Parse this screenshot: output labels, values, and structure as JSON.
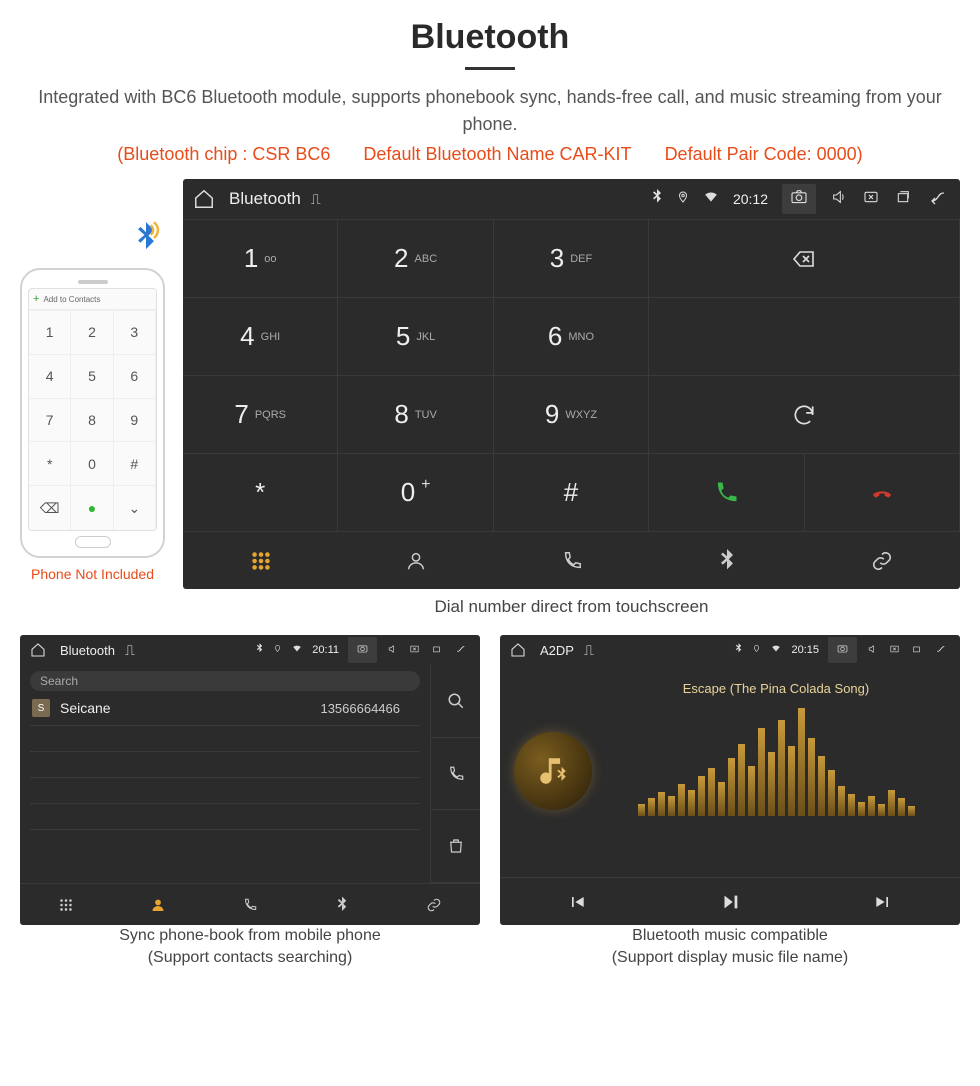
{
  "header": {
    "title": "Bluetooth",
    "desc": "Integrated with BC6 Bluetooth module, supports phonebook sync, hands-free call, and music streaming from your phone.",
    "spec_chip": "(Bluetooth chip : CSR BC6",
    "spec_name": "Default Bluetooth Name CAR-KIT",
    "spec_code": "Default Pair Code: 0000)"
  },
  "phone": {
    "add_label": "Add to Contacts",
    "note": "Phone Not Included",
    "keys": [
      "1",
      "2",
      "3",
      "4",
      "5",
      "6",
      "7",
      "8",
      "9",
      "*",
      "0",
      "#"
    ]
  },
  "dialer": {
    "statusbar": {
      "title": "Bluetooth",
      "time": "20:12"
    },
    "keys": [
      {
        "n": "1",
        "s": "ᴏᴏ"
      },
      {
        "n": "2",
        "s": "ABC"
      },
      {
        "n": "3",
        "s": "DEF"
      },
      {
        "n": "4",
        "s": "GHI"
      },
      {
        "n": "5",
        "s": "JKL"
      },
      {
        "n": "6",
        "s": "MNO"
      },
      {
        "n": "7",
        "s": "PQRS"
      },
      {
        "n": "8",
        "s": "TUV"
      },
      {
        "n": "9",
        "s": "WXYZ"
      },
      {
        "n": "*",
        "s": ""
      },
      {
        "n": "0",
        "s": "+",
        "sup": true
      },
      {
        "n": "#",
        "s": ""
      }
    ],
    "caption": "Dial number direct from touchscreen"
  },
  "phonebook": {
    "statusbar": {
      "title": "Bluetooth",
      "time": "20:11"
    },
    "search_placeholder": "Search",
    "contact": {
      "initial": "S",
      "name": "Seicane",
      "number": "13566664466"
    },
    "caption_line1": "Sync phone-book from mobile phone",
    "caption_line2": "(Support contacts searching)"
  },
  "music": {
    "statusbar": {
      "title": "A2DP",
      "time": "20:15"
    },
    "track": "Escape (The Pina Colada Song)",
    "eq_bars": [
      12,
      18,
      24,
      20,
      32,
      26,
      40,
      48,
      34,
      58,
      72,
      50,
      88,
      64,
      96,
      70,
      108,
      78,
      60,
      46,
      30,
      22,
      14,
      20,
      12,
      26,
      18,
      10
    ],
    "caption_line1": "Bluetooth music compatible",
    "caption_line2": "(Support display music file name)"
  }
}
